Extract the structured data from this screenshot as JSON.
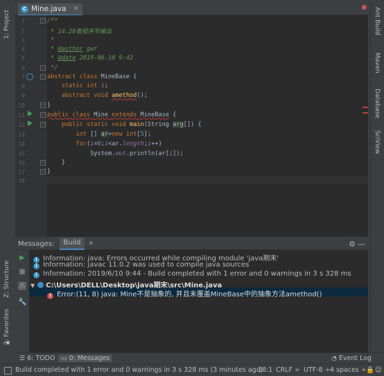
{
  "editor": {
    "tab_label": "Mine.java",
    "tab_icon": "C",
    "lines": [
      "1",
      "2",
      "3",
      "4",
      "5",
      "6",
      "7",
      "8",
      "9",
      "10",
      "11",
      "12",
      "13",
      "14",
      "15",
      "16",
      "17",
      "18"
    ]
  },
  "left_stripe": {
    "project": "1: Project",
    "structure": "Z: Structure",
    "favorites": "2: Favorites"
  },
  "right_stripe": {
    "ant": "Ant Build",
    "maven": "Maven",
    "database": "Database",
    "sciview": "SciView"
  },
  "panel": {
    "title": "Messages:",
    "tab": "Build",
    "messages": [
      "Information: java: Errors occurred while compiling module 'java期末'",
      "Information: javac 11.0.2 was used to compile java sources",
      "Information: 2019/6/10 9:44 - Build completed with 1 error and 0 warnings in 3 s 328 ms"
    ],
    "file_path": "C:\\Users\\DELL\\Desktop\\java期末\\src\\Mine.java",
    "error": "Error:(11, 8)  java: Mine不是抽象的, 并且未覆盖MineBase中的抽象方法amethod()"
  },
  "bottom_tabs": {
    "todo": "6: TODO",
    "messages": "0: Messages",
    "event_log": "Event Log"
  },
  "status": {
    "text": "Build completed with 1 error and 0 warnings in 3 s 328 ms (3 minutes ago)",
    "position": "18:1",
    "line_sep": "CRLF ÷",
    "encoding": "UTF-8 ÷",
    "indent": "4 spaces ÷"
  },
  "colors": {
    "keyword": "#cc7832",
    "comment": "#629755",
    "error": "#c75450",
    "info": "#3592c4",
    "run": "#499c54"
  }
}
